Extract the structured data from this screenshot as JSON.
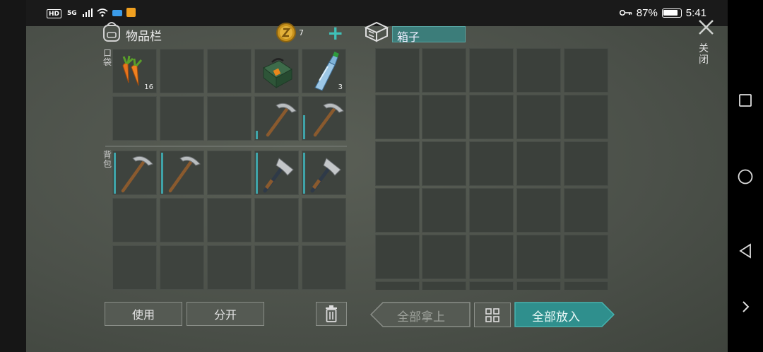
{
  "status_bar": {
    "left_icons": [
      "HD",
      "5G",
      "wifi-icon",
      "speed-icon",
      "notification-icon"
    ],
    "battery_percent": "87%",
    "time": "5:41"
  },
  "inventory": {
    "title": "物品栏",
    "coins": "7",
    "add_label": "+",
    "pocket_label": "口袋",
    "backpack_label": "背包",
    "pocket_items": [
      {
        "icon": "carrot-icon",
        "count": "16"
      },
      {
        "icon": "",
        "count": ""
      },
      {
        "icon": "",
        "count": ""
      },
      {
        "icon": "toolbox-icon",
        "count": ""
      },
      {
        "icon": "water-bottle-icon",
        "count": "3"
      },
      {
        "icon": "",
        "count": ""
      },
      {
        "icon": "",
        "count": ""
      },
      {
        "icon": "",
        "count": ""
      },
      {
        "icon": "pickaxe-icon",
        "count": "",
        "durability": 0.2
      },
      {
        "icon": "pickaxe-icon",
        "count": "",
        "durability": 0.55
      }
    ],
    "backpack_items": [
      {
        "icon": "pickaxe-icon",
        "durability": 0.9
      },
      {
        "icon": "pickaxe-icon",
        "durability": 0.9
      },
      {
        "icon": "",
        "durability": 0
      },
      {
        "icon": "hatchet-icon",
        "durability": 0.9
      },
      {
        "icon": "hatchet-icon",
        "durability": 0.9
      }
    ],
    "use_label": "使用",
    "split_label": "分开"
  },
  "box": {
    "title": "箱子",
    "take_all_label": "全部拿上",
    "put_all_label": "全部放入"
  },
  "close_label": "关闭",
  "colors": {
    "accent": "#3fa3a8",
    "put_all_bg": "#2f8f8d",
    "background": "#4b5049"
  }
}
